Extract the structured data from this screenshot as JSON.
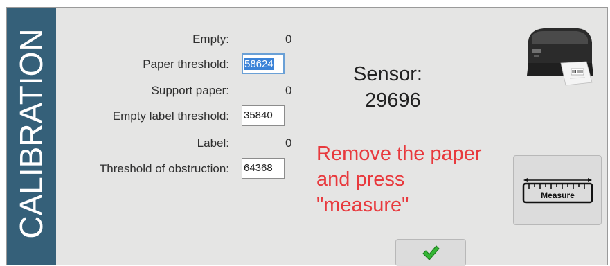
{
  "sidebar": {
    "title": "CALIBRATION"
  },
  "fields": [
    {
      "label": "Empty:",
      "value": "0"
    },
    {
      "label": "Paper threshold:",
      "input": "58624"
    },
    {
      "label": "Support paper:",
      "value": "0"
    },
    {
      "label": "Empty label threshold:",
      "input": "35840"
    },
    {
      "label": "Label:",
      "value": "0"
    },
    {
      "label": "Threshold of obstruction:",
      "input": "64368"
    }
  ],
  "sensor": {
    "label": "Sensor:",
    "value": "29696"
  },
  "message": {
    "lines": [
      "Remove the paper",
      "and press",
      "\"measure\""
    ],
    "color": "#e8393d"
  },
  "measure_button": {
    "label": "Measure",
    "icon": "ruler-icon"
  },
  "ok_button": {
    "icon": "checkmark-icon",
    "color": "#2eaa2e"
  },
  "printer": {
    "icon": "label-printer-icon"
  },
  "colors": {
    "sidebar": "#356079",
    "background": "#e5e5e4",
    "selection": "#3b83d8"
  }
}
